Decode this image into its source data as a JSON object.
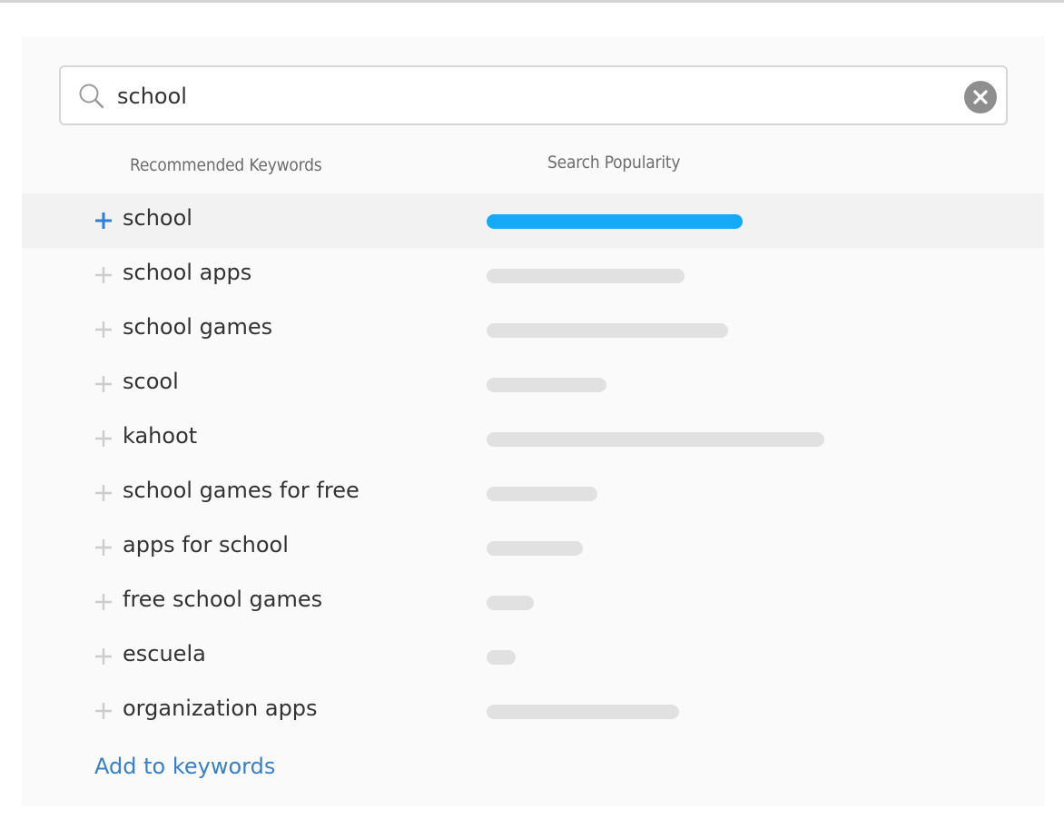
{
  "search": {
    "value": "school",
    "icon": "search-icon",
    "clear_icon": "clear-circle-x-icon"
  },
  "columns": {
    "keywords": "Recommended Keywords",
    "popularity": "Search Popularity"
  },
  "colors": {
    "selected_bar": "#14aaf5",
    "default_bar": "#e1e1e1",
    "selected_plus": "#2f7fd6",
    "default_plus": "#cccccc",
    "link": "#3a7fc4"
  },
  "keywords": [
    {
      "label": "school",
      "popularity": 70.5,
      "selected": true
    },
    {
      "label": "school apps",
      "popularity": 54.5,
      "selected": false
    },
    {
      "label": "school games",
      "popularity": 66.5,
      "selected": false
    },
    {
      "label": "scool",
      "popularity": 33,
      "selected": false
    },
    {
      "label": "kahoot",
      "popularity": 93,
      "selected": false
    },
    {
      "label": "school games for free",
      "popularity": 30.5,
      "selected": false
    },
    {
      "label": "apps for school",
      "popularity": 26.5,
      "selected": false
    },
    {
      "label": "free school games",
      "popularity": 13,
      "selected": false
    },
    {
      "label": "escuela",
      "popularity": 8,
      "selected": false
    },
    {
      "label": "organization apps",
      "popularity": 53,
      "selected": false
    }
  ],
  "footer": {
    "add_label": "Add to keywords"
  }
}
